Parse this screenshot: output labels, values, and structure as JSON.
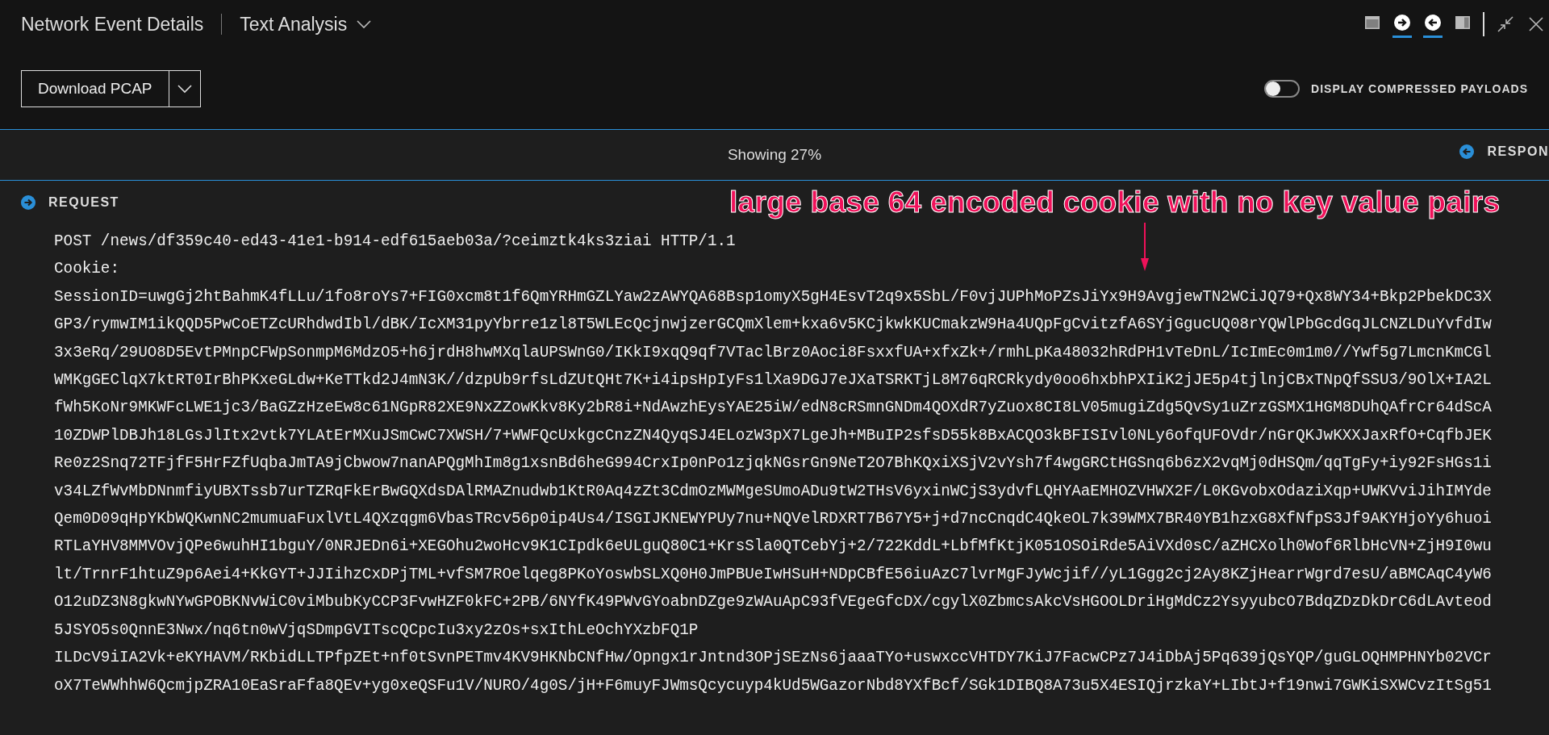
{
  "header": {
    "title": "Network Event Details",
    "view": "Text Analysis",
    "view_buttons": [
      {
        "kind": "top-panel",
        "selected": false
      },
      {
        "kind": "right-arrow",
        "selected": true
      },
      {
        "kind": "left-arrow",
        "selected": true
      },
      {
        "kind": "side-panel",
        "selected": false
      }
    ]
  },
  "toolbar": {
    "download_button": "Download PCAP",
    "toggle": {
      "label": "DISPLAY COMPRESSED PAYLOADS",
      "on": false
    }
  },
  "status": {
    "text": "Showing 27%",
    "response_label": "RESPON"
  },
  "request": {
    "label": "REQUEST",
    "expanded": true,
    "lines": [
      "POST /news/df359c40-ed43-41e1-b914-edf615aeb03a/?ceimztk4ks3ziai HTTP/1.1",
      "Cookie:",
      "SessionID=uwgGj2htBahmK4fLLu/1fo8roYs7+FIG0xcm8t1f6QmYRHmGZLYaw2zAWYQA68Bsp1omyX5gH4EsvT2q9x5SbL/F0vjJUPhMoPZsJiYx9H9AvgjewTN2WCiJQ79+Qx8WY34+Bkp2PbekDC3X",
      "GP3/rymwIM1ikQQD5PwCoETZcURhdwdIbl/dBK/IcXM31pyYbrre1zl8T5WLEcQcjnwjzerGCQmXlem+kxa6v5KCjkwkKUCmakzW9Ha4UQpFgCvitzfA6SYjGgucUQ08rYQWlPbGcdGqJLCNZLDuYvfdIw",
      "3x3eRq/29UO8D5EvtPMnpCFWpSonmpM6MdzO5+h6jrdH8hwMXqlaUPSWnG0/IKkI9xqQ9qf7VTaclBrz0Aoci8FsxxfUA+xfxZk+/rmhLpKa48032hRdPH1vTeDnL/IcImEc0m1m0//Ywf5g7LmcnKmCGl",
      "WMKgGEClqX7ktRT0IrBhPKxeGLdw+KeTTkd2J4mN3K//dzpUb9rfsLdZUtQHt7K+i4ipsHpIyFs1lXa9DGJ7eJXaTSRKTjL8M76qRCRkydy0oo6hxbhPXIiK2jJE5p4tjlnjCBxTNpQfSSU3/9OlX+IA2L",
      "fWh5KoNr9MKWFcLWE1jc3/BaGZzHzeEw8c61NGpR82XE9NxZZowKkv8Ky2bR8i+NdAwzhEysYAE25iW/edN8cRSmnGNDm4QOXdR7yZuox8CI8LV05mugiZdg5QvSy1uZrzGSMX1HGM8DUhQAfrCr64dScA",
      "10ZDWPlDBJh18LGsJlItx2vtk7YLAtErMXuJSmCwC7XWSH/7+WWFQcUxkgcCnzZN4QyqSJ4ELozW3pX7LgeJh+MBuIP2sfsD55k8BxACQO3kBFISIvl0NLy6ofqUFOVdr/nGrQKJwKXXJaxRfO+CqfbJEK",
      "Re0z2Snq72TFjfF5HrFZfUqbaJmTA9jCbwow7nanAPQgMhIm8g1xsnBd6heG994CrxIp0nPo1zjqkNGsrGn9NeT2O7BhKQxiXSjV2vYsh7f4wgGRCtHGSnq6b6zX2vqMj0dHSQm/qqTgFy+iy92FsHGs1i",
      "v34LZfWvMbDNnmfiyUBXTssb7urTZRqFkErBwGQXdsDAlRMAZnudwb1KtR0Aq4zZt3CdmOzMWMgeSUmoADu9tW2THsV6yxinWCjS3ydvfLQHYAaEMHOZVHWX2F/L0KGvobxOdaziXqp+UWKVviJihIMYde",
      "Qem0D09qHpYKbWQKwnNC2mumuaFuxlVtL4QXzqgm6VbasTRcv56p0ip4Us4/ISGIJKNEWYPUy7nu+NQVelRDXRT7B67Y5+j+d7ncCnqdC4QkeOL7k39WMX7BR40YB1hzxG8XfNfpS3Jf9AKYHjoYy6huoi",
      "RTLaYHV8MMVOvjQPe6wuhHI1bguY/0NRJEDn6i+XEGOhu2woHcv9K1CIpdk6eULguQ80C1+KrsSla0QTCebYj+2/722KddL+LbfMfKtjK051OSOiRde5AiVXd0sC/aZHCXolh0Wof6RlbHcVN+ZjH9I0wu",
      "lt/TrnrF1htuZ9p6Aei4+KkGYT+JJIihzCxDPjTML+vfSM7ROelqeg8PKoYoswbSLXQ0H0JmPBUeIwHSuH+NDpCBfE56iuAzC7lvrMgFJyWcjif//yL1Ggg2cj2Ay8KZjHearrWgrd7esU/aBMCAqC4yW6",
      "O12uDZ3N8gkwNYwGPOBKNvWiC0viMbubKyCCP3FvwHZF0kFC+2PB/6NYfK49PWvGYoabnDZge9zWAuApC93fVEgeGfcDX/cgylX0ZbmcsAkcVsHGOOLDriHgMdCz2YsyyubcO7BdqZDzDkDrC6dLAvteod",
      "5JSYO5s0QnnE3Nwx/nq6tn0wVjqSDmpGVITscQCpcIu3xy2zOs+sxIthLeOchYXzbFQ1P",
      "ILDcV9iIA2Vk+eKYHAVM/RKbidLLTPfpZEt+nf0tSvnPETmv4KV9HKNbCNfHw/Opngx1rJntnd3OPjSEzNs6jaaaTYo+uswxccVHTDY7KiJ7FacwCPz7J4iDbAj5Pq639jQsYQP/guGLOQHMPHNYb02VCr",
      "oX7TeWWhhW6QcmjpZRA10EaSraFfa8QEv+yg0xeQSFu1V/NURO/4g0S/jH+F6muyFJWmsQcycuyp4kUd5WGazorNbd8YXfBcf/SGk1DIBQ8A73u5X4ESIQjrzkaY+LIbtJ+f19nwi7GWKiSXWCvzItSg51"
    ]
  },
  "annotation": {
    "text": "large base 64 encoded cookie with no key value pairs"
  }
}
